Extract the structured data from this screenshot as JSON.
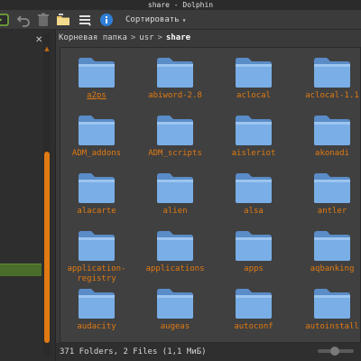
{
  "window": {
    "title": "share - Dolphin"
  },
  "toolbar": {
    "sort_label": "Сортировать",
    "icons": [
      "terminal-icon",
      "undo-icon",
      "trash-icon",
      "new-folder-icon",
      "menu-icon",
      "info-icon"
    ]
  },
  "breadcrumb": {
    "items": [
      "Корневая папка",
      "usr",
      "share"
    ],
    "separator": ">"
  },
  "folders": [
    "a2ps",
    "abiword-2.8",
    "aclocal",
    "aclocal-1.1",
    "ADM_addons",
    "ADM_scripts",
    "aisleriot",
    "akonadi",
    "alacarte",
    "alien",
    "alsa",
    "antler",
    "application-\nregistry",
    "applications",
    "apps",
    "aqbanking",
    "audacity",
    "augeas",
    "autoconf",
    "autoinstall"
  ],
  "status": {
    "summary": "371 Folders, 2 Files (1,1 MиБ)"
  },
  "colors": {
    "accent": "#e07a12",
    "folder": "#6c9fd6",
    "background": "#404040"
  }
}
